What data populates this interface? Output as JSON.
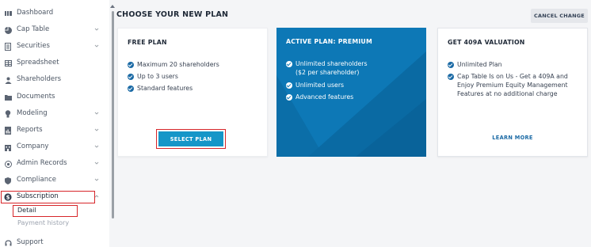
{
  "sidebar": {
    "items": [
      {
        "label": "Dashboard",
        "icon": "dashboard-icon"
      },
      {
        "label": "Cap Table",
        "icon": "pie-chart-icon"
      },
      {
        "label": "Securities",
        "icon": "document-icon"
      },
      {
        "label": "Spreadsheet",
        "icon": "spreadsheet-icon"
      },
      {
        "label": "Shareholders",
        "icon": "person-icon"
      },
      {
        "label": "Documents",
        "icon": "folder-icon"
      },
      {
        "label": "Modeling",
        "icon": "lightbulb-icon"
      },
      {
        "label": "Reports",
        "icon": "report-icon"
      },
      {
        "label": "Company",
        "icon": "building-icon"
      },
      {
        "label": "Admin Records",
        "icon": "records-icon"
      },
      {
        "label": "Compliance",
        "icon": "shield-icon"
      },
      {
        "label": "Subscription",
        "icon": "dollar-icon"
      },
      {
        "label": "Support",
        "icon": "headset-icon"
      }
    ],
    "sub_items": [
      {
        "label": "Detail"
      },
      {
        "label": "Payment history"
      }
    ]
  },
  "main": {
    "title": "CHOOSE YOUR NEW PLAN",
    "cancel_label": "CANCEL CHANGE",
    "cards": [
      {
        "title": "FREE PLAN",
        "features": [
          "Maximum 20 shareholders",
          "Up to 3 users",
          "Standard features"
        ],
        "button": "SELECT PLAN"
      },
      {
        "title": "ACTIVE PLAN: PREMIUM",
        "features": [
          "Unlimited shareholders",
          "($2 per shareholder)",
          "Unlimited users",
          "Advanced features"
        ]
      },
      {
        "title": "GET 409A VALUATION",
        "features": [
          "Unlimited Plan",
          "Cap Table Is on Us - Get a 409A and",
          "Enjoy Premium Equity Management",
          "Features at no additional charge"
        ],
        "link": "LEARN MORE"
      }
    ]
  },
  "colors": {
    "accent": "#0d78b6",
    "button": "#1596c8",
    "highlight": "#d7262a",
    "check": "#1b6aa5"
  }
}
